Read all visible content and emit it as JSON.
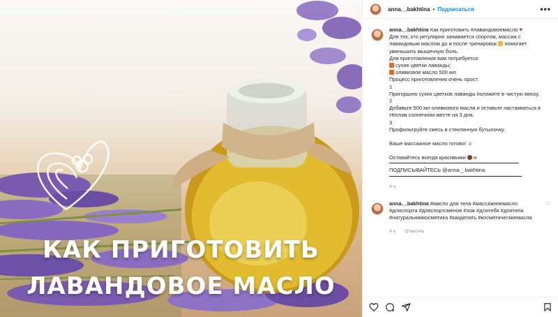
{
  "post": {
    "headline_line1": "Как приготовить",
    "headline_line2": "лавандовое масло"
  },
  "header": {
    "username": "anna._.bakhtina",
    "separator": "•",
    "follow_label": "Подписаться",
    "more_label": "•••"
  },
  "caption": {
    "username": "anna._.bakhtina",
    "lines": [
      "Как приготовить #лавандовоемасло",
      "Для тех, кто регулярно занимается спортом, массаж с",
      "лавандовым маслом до и после тренировок",
      "помогает",
      "уменьшить мышечную боль.",
      "Для приготовления вам потребуется:",
      "сухие цветки лаванды;",
      "оливковое масло 500 мл.",
      "Процесс приготовления очень прост:",
      "1",
      "Пригоршню сухих цветков лаванды положите в чистую миску.",
      "2",
      "Добавьте 500 мл оливкового масла и оставьте настаиваться в",
      "тёплом солнечном месте на 3 дня.",
      "3",
      "Профильтруйте смесь в стеклянную бутылочку.",
      "Ваше массажное масло готово!",
      "Оставайтесь всегда красивыми",
      "и",
      "ПОДПИСЫВАЙТЕСЬ @anna._.bakhtina"
    ],
    "time": "4 ч."
  },
  "comment": {
    "username": "anna._.bakhtina",
    "lines": [
      "#масло для тела #массажноемасло",
      "#дляспорта #дляспортсменов #зож #длятебя #длятела",
      "#натуральнаякосметика #какделать #косметическиемасла"
    ],
    "time": "4 ч.",
    "reply_label": "Ответить"
  },
  "colors": {
    "accent": "#0095f6",
    "lavender": "#7d5fb5",
    "oil": "#d9b327"
  },
  "icons": [
    "heart-icon",
    "comment-icon",
    "share-icon",
    "bookmark-icon"
  ]
}
